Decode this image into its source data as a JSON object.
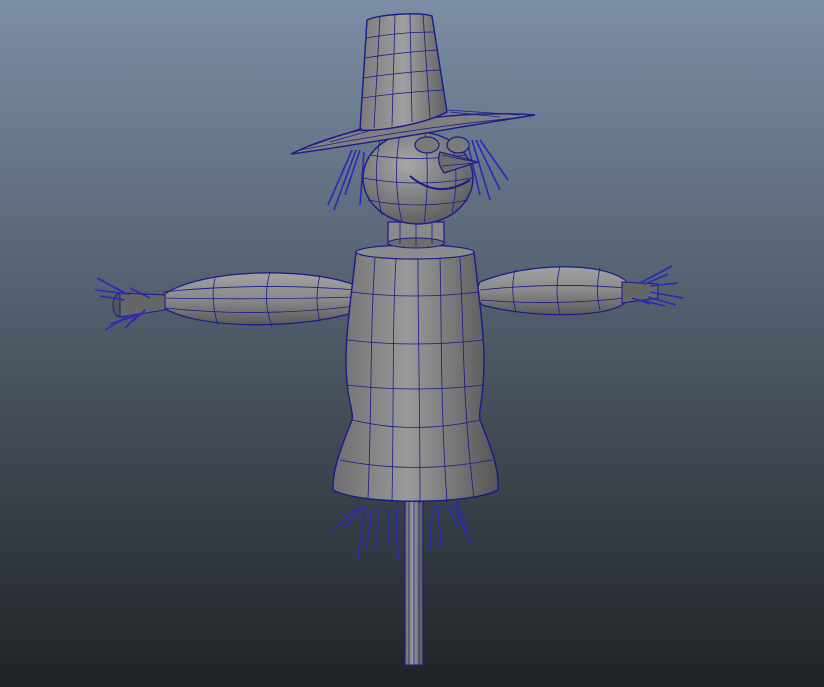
{
  "viewport": {
    "background_top": "#7c8ea5",
    "background_bottom": "#1f2326",
    "shade_light": "#9a9a9a",
    "shade_dark": "#5f5f5f",
    "wire_color": "#1a1a8c",
    "straw_color": "#2a2ab8"
  },
  "scene": {
    "model": "scarecrow",
    "display_mode": "shaded-with-wireframe"
  }
}
